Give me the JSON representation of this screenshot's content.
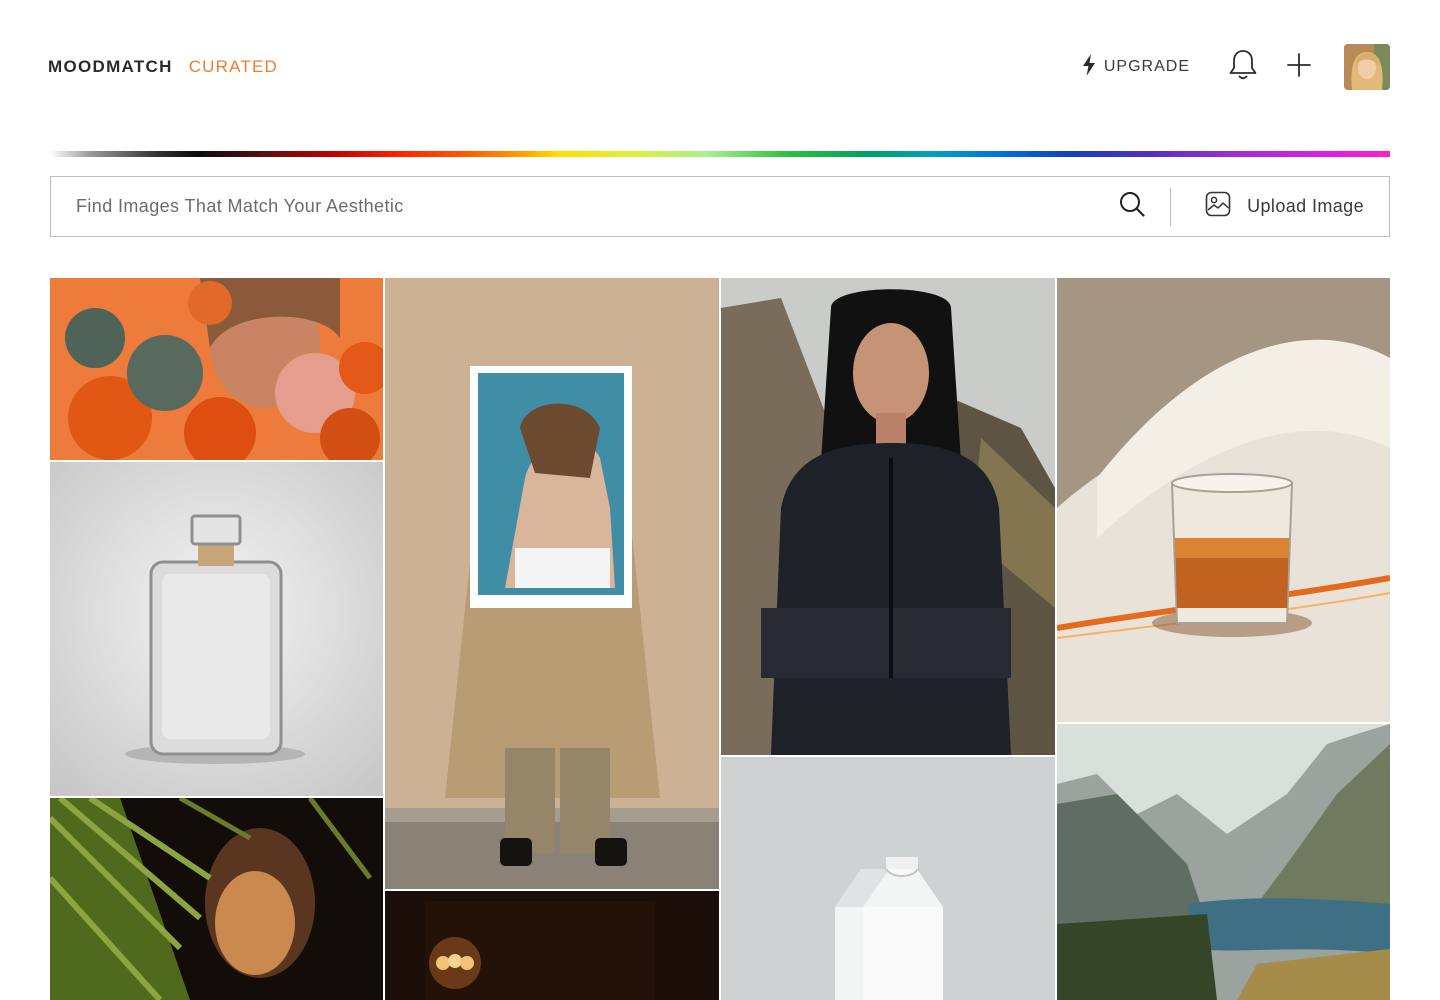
{
  "brand": {
    "name": "MOODMATCH",
    "tag": "CURATED",
    "tag_color": "#ef7d2c"
  },
  "header": {
    "upgrade_label": "UPGRADE",
    "icons": [
      "bolt-icon",
      "bell-icon",
      "plus-icon",
      "avatar"
    ]
  },
  "search": {
    "placeholder": "Find Images That Match Your Aesthetic",
    "value": "",
    "upload_label": "Upload Image"
  },
  "gallery": {
    "images": [
      "woman-with-orange-flowers",
      "glass-decanter-bottle",
      "woman-with-palm-leaves",
      "person-holding-portrait-poster",
      "dim-lamp-interior",
      "woman-in-black-sportswear",
      "white-milk-carton",
      "whisky-glass-light",
      "mountain-lake-valley"
    ]
  }
}
